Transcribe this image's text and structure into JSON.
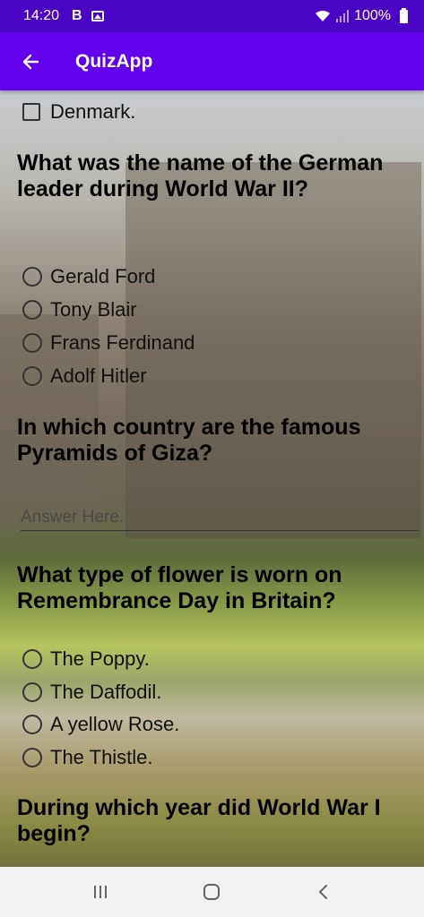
{
  "status_bar": {
    "time": "14:20",
    "notif_letter": "B",
    "battery": "100%",
    "icons": [
      "image-icon",
      "wifi-icon",
      "signal-icon",
      "battery-icon"
    ]
  },
  "app_bar": {
    "title": "QuizApp",
    "back_icon": "arrow-back-icon"
  },
  "quiz": {
    "prev_checkbox_label": "Denmark.",
    "q1": {
      "text": "What was the name of the German leader during World War II?",
      "options": [
        "Gerald Ford",
        "Tony Blair",
        "Frans Ferdinand",
        "Adolf Hitler"
      ]
    },
    "q2": {
      "text": "In which country are the famous Pyramids of Giza?",
      "placeholder": "Answer Here."
    },
    "q3": {
      "text": "What type of flower is worn on Remembrance Day in Britain?",
      "options": [
        "The Poppy.",
        "The Daffodil.",
        "A yellow Rose.",
        "The Thistle."
      ]
    },
    "q4": {
      "text": "During which year did World War I begin?"
    }
  },
  "nav_bar": {
    "icons": [
      "recents-icon",
      "home-icon",
      "back-nav-icon"
    ]
  },
  "colors": {
    "status_bar": "#4a05c4",
    "app_bar": "#6200ee",
    "nav_bar": "#f2f2f2"
  }
}
